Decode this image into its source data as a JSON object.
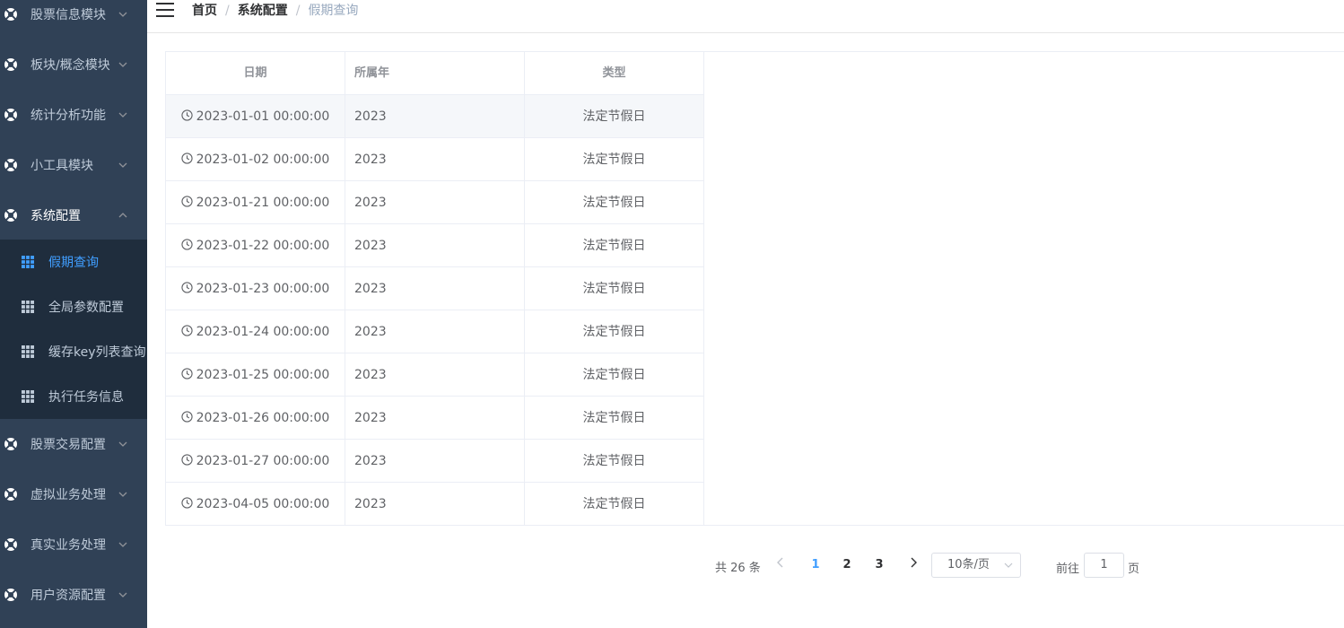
{
  "sidebar": {
    "menus": [
      {
        "label": "股票信息模块",
        "open": false
      },
      {
        "label": "板块/概念模块",
        "open": false
      },
      {
        "label": "统计分析功能",
        "open": false
      },
      {
        "label": "小工具模块",
        "open": false
      },
      {
        "label": "系统配置",
        "open": true
      },
      {
        "label": "股票交易配置",
        "open": false
      },
      {
        "label": "虚拟业务处理",
        "open": false
      },
      {
        "label": "真实业务处理",
        "open": false
      },
      {
        "label": "用户资源配置",
        "open": false
      }
    ],
    "submenu": [
      {
        "label": "假期查询",
        "active": true
      },
      {
        "label": "全局参数配置",
        "active": false
      },
      {
        "label": "缓存key列表查询",
        "active": false
      },
      {
        "label": "执行任务信息",
        "active": false
      }
    ]
  },
  "breadcrumb": {
    "home": "首页",
    "section": "系统配置",
    "current": "假期查询",
    "separator": "/"
  },
  "table": {
    "headers": {
      "date": "日期",
      "year": "所属年",
      "type": "类型"
    },
    "rows": [
      {
        "date": "2023-01-01 00:00:00",
        "year": "2023",
        "type": "法定节假日"
      },
      {
        "date": "2023-01-02 00:00:00",
        "year": "2023",
        "type": "法定节假日"
      },
      {
        "date": "2023-01-21 00:00:00",
        "year": "2023",
        "type": "法定节假日"
      },
      {
        "date": "2023-01-22 00:00:00",
        "year": "2023",
        "type": "法定节假日"
      },
      {
        "date": "2023-01-23 00:00:00",
        "year": "2023",
        "type": "法定节假日"
      },
      {
        "date": "2023-01-24 00:00:00",
        "year": "2023",
        "type": "法定节假日"
      },
      {
        "date": "2023-01-25 00:00:00",
        "year": "2023",
        "type": "法定节假日"
      },
      {
        "date": "2023-01-26 00:00:00",
        "year": "2023",
        "type": "法定节假日"
      },
      {
        "date": "2023-01-27 00:00:00",
        "year": "2023",
        "type": "法定节假日"
      },
      {
        "date": "2023-04-05 00:00:00",
        "year": "2023",
        "type": "法定节假日"
      }
    ]
  },
  "pagination": {
    "total_text": "共 26 条",
    "pages": [
      "1",
      "2",
      "3"
    ],
    "current_page": "1",
    "page_size": "10条/页",
    "goto_label": "前往",
    "goto_value": "1",
    "page_suffix": "页"
  },
  "colors": {
    "sidebar_bg": "#304156",
    "submenu_bg": "#1f2d3d",
    "accent": "#409eff",
    "menu_text": "#bfcbd9"
  },
  "icons": {
    "menu": "lifebuoy-icon",
    "submenu": "grid-table-icon",
    "arrow": "chevron-icon",
    "clock": "clock-icon",
    "hamburger": "hamburger-icon"
  }
}
